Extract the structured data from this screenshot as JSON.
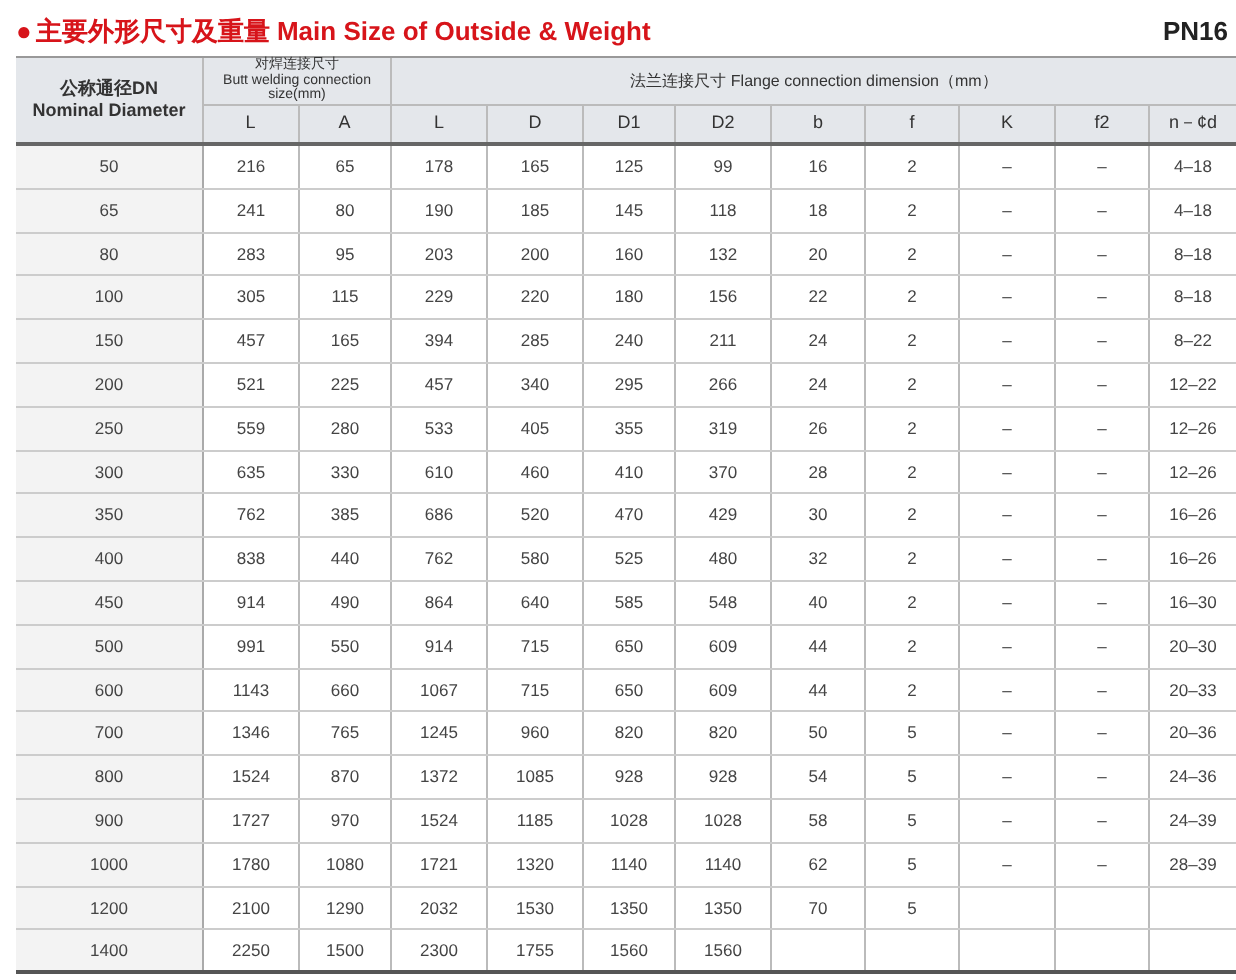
{
  "title": {
    "bullet": "●",
    "text": "主要外形尺寸及重量 Main Size of Outside & Weight"
  },
  "pressure_class": "PN16",
  "table": {
    "first_column_header": {
      "zh": "公称通径DN",
      "en": "Nominal Diameter"
    },
    "groups": [
      {
        "zh": "对焊连接尺寸",
        "en": "Butt welding connection size(mm)"
      },
      {
        "label": "法兰连接尺寸 Flange connection dimension（mm）"
      }
    ],
    "columns": [
      "L",
      "A",
      "L",
      "D",
      "D1",
      "D2",
      "b",
      "f",
      "K",
      "f2",
      "n－¢d"
    ],
    "rows": [
      {
        "dn": "50",
        "cells": [
          "216",
          "65",
          "178",
          "165",
          "125",
          "99",
          "16",
          "2",
          "–",
          "–",
          "4–18"
        ]
      },
      {
        "dn": "65",
        "cells": [
          "241",
          "80",
          "190",
          "185",
          "145",
          "118",
          "18",
          "2",
          "–",
          "–",
          "4–18"
        ]
      },
      {
        "dn": "80",
        "cells": [
          "283",
          "95",
          "203",
          "200",
          "160",
          "132",
          "20",
          "2",
          "–",
          "–",
          "8–18"
        ]
      },
      {
        "dn": "100",
        "cells": [
          "305",
          "115",
          "229",
          "220",
          "180",
          "156",
          "22",
          "2",
          "–",
          "–",
          "8–18"
        ]
      },
      {
        "dn": "150",
        "cells": [
          "457",
          "165",
          "394",
          "285",
          "240",
          "211",
          "24",
          "2",
          "–",
          "–",
          "8–22"
        ]
      },
      {
        "dn": "200",
        "cells": [
          "521",
          "225",
          "457",
          "340",
          "295",
          "266",
          "24",
          "2",
          "–",
          "–",
          "12–22"
        ]
      },
      {
        "dn": "250",
        "cells": [
          "559",
          "280",
          "533",
          "405",
          "355",
          "319",
          "26",
          "2",
          "–",
          "–",
          "12–26"
        ]
      },
      {
        "dn": "300",
        "cells": [
          "635",
          "330",
          "610",
          "460",
          "410",
          "370",
          "28",
          "2",
          "–",
          "–",
          "12–26"
        ]
      },
      {
        "dn": "350",
        "cells": [
          "762",
          "385",
          "686",
          "520",
          "470",
          "429",
          "30",
          "2",
          "–",
          "–",
          "16–26"
        ]
      },
      {
        "dn": "400",
        "cells": [
          "838",
          "440",
          "762",
          "580",
          "525",
          "480",
          "32",
          "2",
          "–",
          "–",
          "16–26"
        ]
      },
      {
        "dn": "450",
        "cells": [
          "914",
          "490",
          "864",
          "640",
          "585",
          "548",
          "40",
          "2",
          "–",
          "–",
          "16–30"
        ]
      },
      {
        "dn": "500",
        "cells": [
          "991",
          "550",
          "914",
          "715",
          "650",
          "609",
          "44",
          "2",
          "–",
          "–",
          "20–30"
        ]
      },
      {
        "dn": "600",
        "cells": [
          "1143",
          "660",
          "1067",
          "715",
          "650",
          "609",
          "44",
          "2",
          "–",
          "–",
          "20–33"
        ]
      },
      {
        "dn": "700",
        "cells": [
          "1346",
          "765",
          "1245",
          "960",
          "820",
          "820",
          "50",
          "5",
          "–",
          "–",
          "20–36"
        ]
      },
      {
        "dn": "800",
        "cells": [
          "1524",
          "870",
          "1372",
          "1085",
          "928",
          "928",
          "54",
          "5",
          "–",
          "–",
          "24–36"
        ]
      },
      {
        "dn": "900",
        "cells": [
          "1727",
          "970",
          "1524",
          "1185",
          "1028",
          "1028",
          "58",
          "5",
          "–",
          "–",
          "24–39"
        ]
      },
      {
        "dn": "1000",
        "cells": [
          "1780",
          "1080",
          "1721",
          "1320",
          "1140",
          "1140",
          "62",
          "5",
          "–",
          "–",
          "28–39"
        ]
      },
      {
        "dn": "1200",
        "cells": [
          "2100",
          "1290",
          "2032",
          "1530",
          "1350",
          "1350",
          "70",
          "5"
        ]
      },
      {
        "dn": "1400",
        "cells": [
          "2250",
          "1500",
          "2300",
          "1755",
          "1560",
          "1560"
        ]
      }
    ]
  }
}
